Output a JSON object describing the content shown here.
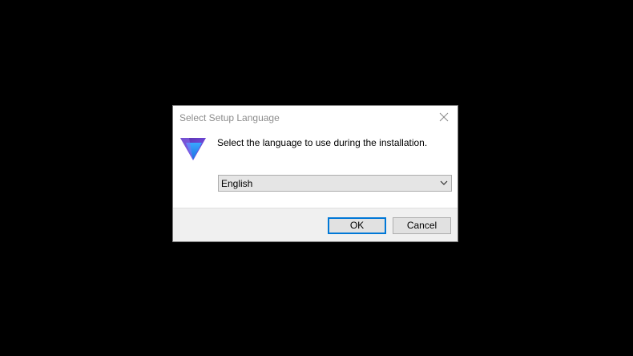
{
  "dialog": {
    "title": "Select Setup Language",
    "prompt": "Select the language to use during the installation.",
    "language_select": {
      "selected": "English"
    },
    "buttons": {
      "ok_label": "OK",
      "cancel_label": "Cancel"
    },
    "icons": {
      "close": "close-icon",
      "app": "app-logo-icon",
      "dropdown": "chevron-down-icon"
    },
    "colors": {
      "accent": "#0078d7",
      "footer_background": "#f0f0f0"
    }
  }
}
